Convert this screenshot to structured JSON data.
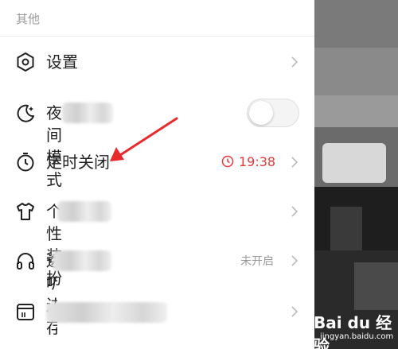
{
  "section": {
    "title": "其他"
  },
  "items": [
    {
      "label": "设置",
      "icon": "hexagon-settings-icon"
    },
    {
      "label": "夜间模式",
      "icon": "moon-icon",
      "toggle_on": false
    },
    {
      "label": "定时关闭",
      "icon": "timer-icon",
      "value": "19:38"
    },
    {
      "label": "个性装扮",
      "icon": "tshirt-icon"
    },
    {
      "label": "边听边存",
      "icon": "headphones-icon",
      "value": "未开启"
    },
    {
      "label": "",
      "icon": "calendar-icon"
    }
  ],
  "colors": {
    "accent_red": "#e8393a",
    "text": "#222222",
    "muted": "#999999"
  },
  "watermark": {
    "main": "Bai du 经验",
    "url": "jingyan.baidu.com"
  }
}
